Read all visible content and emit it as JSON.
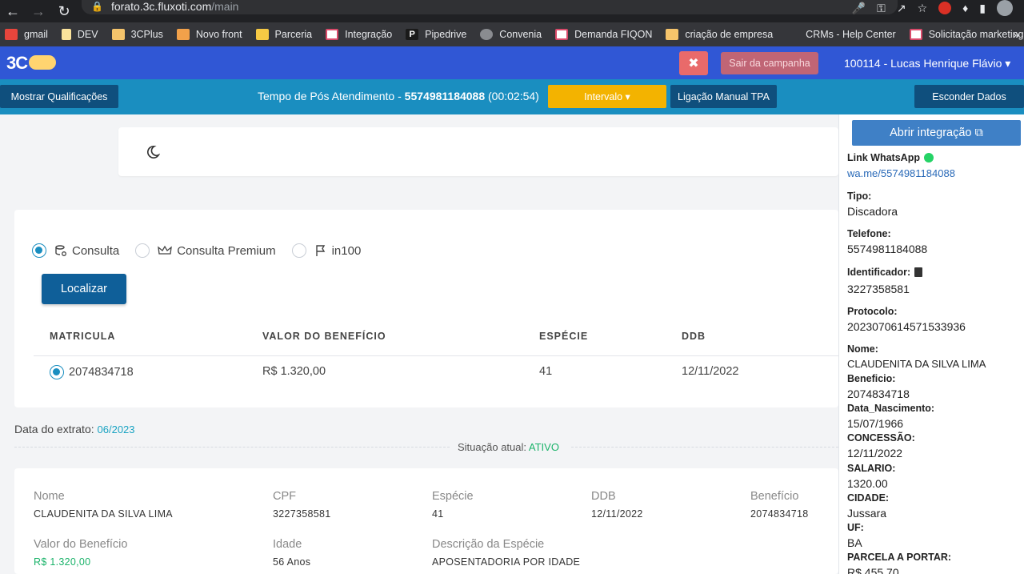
{
  "browser": {
    "url_host": "forato.3c.fluxoti.com",
    "url_path": "/main",
    "bookmarks": [
      "gmail",
      "DEV",
      "3CPlus",
      "Novo front",
      "Parceria",
      "Integração",
      "Pipedrive",
      "Convenia",
      "Demanda  FIQON",
      "criação de empresa",
      "CRMs - Help Center",
      "Solicitação marketing"
    ]
  },
  "header": {
    "logo": "3C",
    "sair_label": "Sair da campanha",
    "user": "100114 - Lucas Henrique Flávio ▾"
  },
  "status_bar": {
    "mostrar_label": "Mostrar Qualificações",
    "timer_prefix": "Tempo de Pós Atendimento - ",
    "phone": "5574981184088",
    "duration": " (00:02:54)",
    "intervalo_label": "Intervalo ▾",
    "ligacao_label": "Ligação Manual TPA",
    "esconder_label": "Esconder Dados"
  },
  "search": {
    "options": [
      "Consulta",
      "Consulta Premium",
      "in100"
    ],
    "selected": "Consulta",
    "button": "Localizar",
    "columns": [
      "MATRICULA",
      "VALOR DO BENEFÍCIO",
      "ESPÉCIE",
      "DDB"
    ],
    "row": {
      "matricula": "2074834718",
      "valor": "R$ 1.320,00",
      "especie": "41",
      "ddb": "12/11/2022"
    }
  },
  "extrato": {
    "label": "Data do extrato: ",
    "value": "06/2023"
  },
  "situacao": {
    "label": "Situação atual: ",
    "value": "ATIVO"
  },
  "info": {
    "nome_label": "Nome",
    "nome": "CLAUDENITA DA SILVA LIMA",
    "cpf_label": "CPF",
    "cpf": "3227358581",
    "especie_label": "Espécie",
    "especie": "41",
    "ddb_label": "DDB",
    "ddb": "12/11/2022",
    "beneficio_label": "Benefício",
    "beneficio": "2074834718",
    "valor_label": "Valor do Benefício",
    "valor": "R$ 1.320,00",
    "idade_label": "Idade",
    "idade": "56 Anos",
    "desc_label": "Descrição da Espécie",
    "desc": "APOSENTADORIA POR IDADE"
  },
  "side": {
    "abrir_label": "Abrir integração ⧉",
    "whatsapp_label": "Link WhatsApp",
    "whatsapp_link": "wa.me/5574981184088",
    "tipo_label": "Tipo:",
    "tipo": "Discadora",
    "telefone_label": "Telefone:",
    "telefone": "5574981184088",
    "identificador_label": "Identificador:",
    "identificador": "3227358581",
    "protocolo_label": "Protocolo:",
    "protocolo": "2023070614571533936",
    "nome_label": "Nome:",
    "nome": "CLAUDENITA DA SILVA LIMA",
    "beneficio_label": "Beneficio:",
    "beneficio": "2074834718",
    "nasc_label": "Data_Nascimento:",
    "nasc": "15/07/1966",
    "concessao_label": "CONCESSÃO:",
    "concessao": "12/11/2022",
    "salario_label": "SALARIO:",
    "salario": "1320.00",
    "cidade_label": "CIDADE:",
    "cidade": "Jussara",
    "uf_label": "UF:",
    "uf": "BA",
    "parcela_label": "PARCELA A PORTAR:",
    "parcela": "R$ 455,70"
  }
}
